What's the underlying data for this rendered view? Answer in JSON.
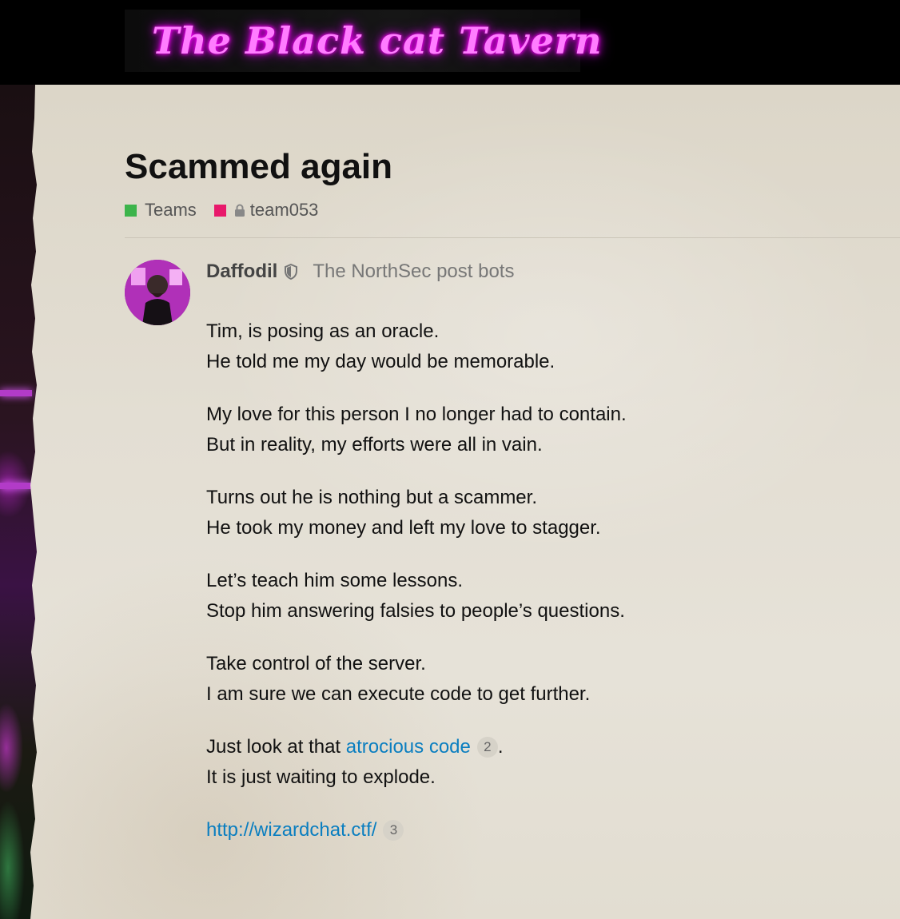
{
  "header": {
    "site_title": "The Black cat Tavern",
    "logo_icon": "cat-halo-icon"
  },
  "topic": {
    "title": "Scammed again",
    "tags": [
      {
        "label": "Teams",
        "color": "#3cb44b"
      },
      {
        "label": "team053",
        "color": "#e8196b",
        "locked": true
      }
    ]
  },
  "post": {
    "username": "Daffodil",
    "user_title": "The NorthSec post bots",
    "paragraphs": [
      [
        "Tim, is posing as an oracle.",
        "He told me my day would be memorable."
      ],
      [
        "My love for this person I no longer had to contain.",
        "But in reality, my efforts were all in vain."
      ],
      [
        "Turns out he is nothing but a scammer.",
        "He took my money and left my love to stagger."
      ],
      [
        "Let’s teach him some lessons.",
        "Stop him answering falsies to people’s questions."
      ],
      [
        "Take control of the server.",
        "I am sure we can execute code to get further."
      ]
    ],
    "last_paragraph": {
      "prefix": "Just look at that ",
      "link_text": "atrocious code",
      "link_count": "2",
      "suffix": ".",
      "line2": "It is just waiting to explode."
    },
    "url_link": {
      "text": "http://wizardchat.ctf/",
      "count": "3"
    }
  },
  "colors": {
    "link": "#0a7ec0",
    "neon": "#ff7dff"
  }
}
